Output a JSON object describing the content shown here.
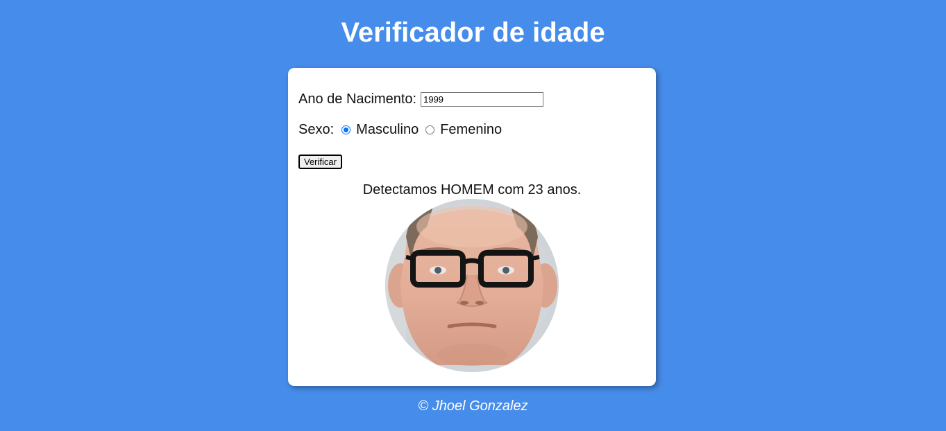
{
  "header": {
    "title": "Verificador de idade"
  },
  "form": {
    "year_label": "Ano de Nacimento:",
    "year_value": "1999",
    "sex_label": "Sexo:",
    "sex_options": [
      "Masculino",
      "Femenino"
    ],
    "sex_selected": "Masculino",
    "verify_label": "Verificar"
  },
  "result": {
    "message": "Detectamos HOMEM com 23 anos.",
    "image": "man-portrait-with-glasses"
  },
  "footer": {
    "credit": "© Jhoel Gonzalez"
  },
  "colors": {
    "background": "#468cea",
    "card": "#ffffff",
    "radio_accent": "#0075ff"
  }
}
